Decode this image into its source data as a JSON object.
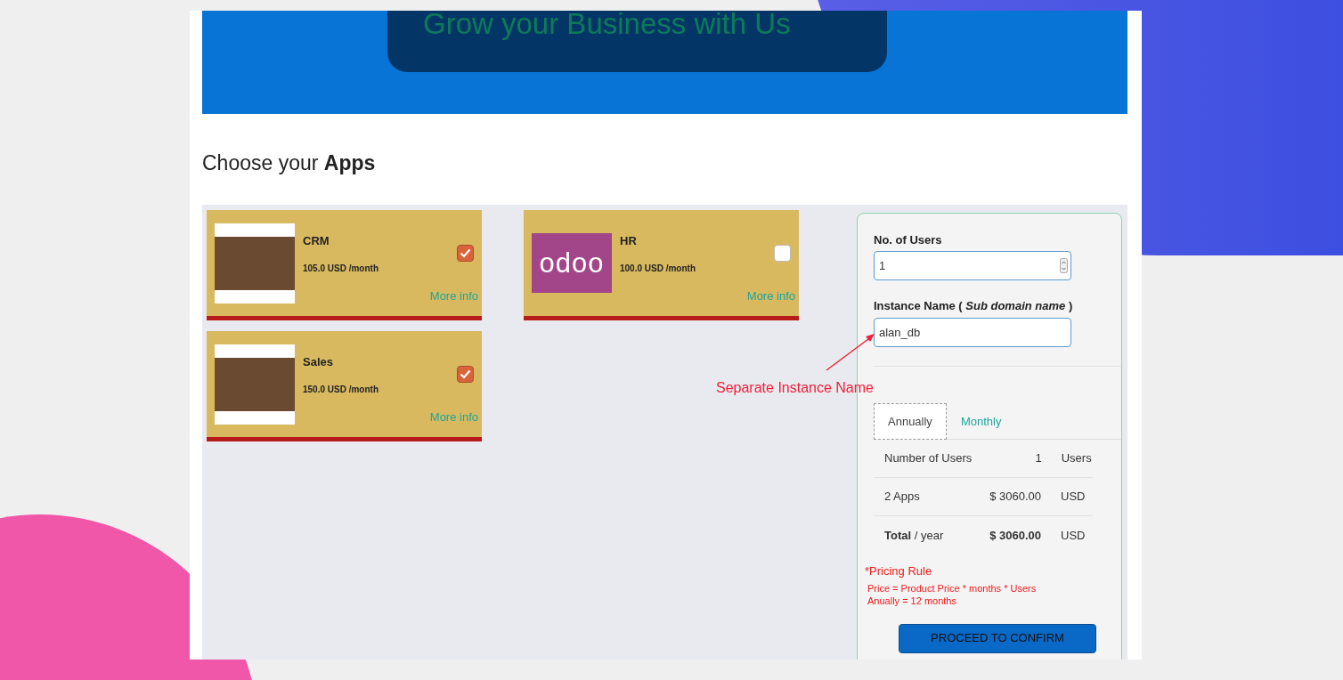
{
  "banner": {
    "title": "Grow your Business with Us"
  },
  "heading": "Choose your **Apps**",
  "apps": [
    {
      "name": "CRM",
      "price": "105.0 USD /month",
      "link": "More info",
      "checked": true,
      "kind": "photo"
    },
    {
      "name": "HR",
      "price": "100.0 USD /month",
      "link": "More info",
      "checked": false,
      "kind": "logo",
      "logo_text": "odoo"
    },
    {
      "name": "Sales",
      "price": "150.0 USD /month",
      "link": "More info",
      "checked": true,
      "kind": "photo"
    }
  ],
  "form": {
    "users_label": "No. of Users",
    "users_value": "1",
    "instance_label": "Instance Name ( *Sub domain name* )",
    "instance_value": "alan_db"
  },
  "annotation": "Separate Instance Name",
  "tabs": [
    {
      "label": "Annually",
      "selected": true
    },
    {
      "label": "Monthly",
      "selected": false
    }
  ],
  "summary": [
    {
      "label": "Number of Users",
      "value": "1",
      "unit": "Users",
      "kind": "plain"
    },
    {
      "label": "2 Apps",
      "value": "$ 3060.00",
      "unit": "USD",
      "kind": "plain"
    },
    {
      "label": "**Total** / year",
      "value": "$ 3060.00",
      "unit": "USD",
      "kind": "total"
    }
  ],
  "pricing_rule": {
    "title": "*Pricing Rule",
    "lines": [
      "Price = Product Price * months * Users",
      "Anually = 12 months"
    ]
  },
  "button": "PROCEED TO CONFIRM"
}
